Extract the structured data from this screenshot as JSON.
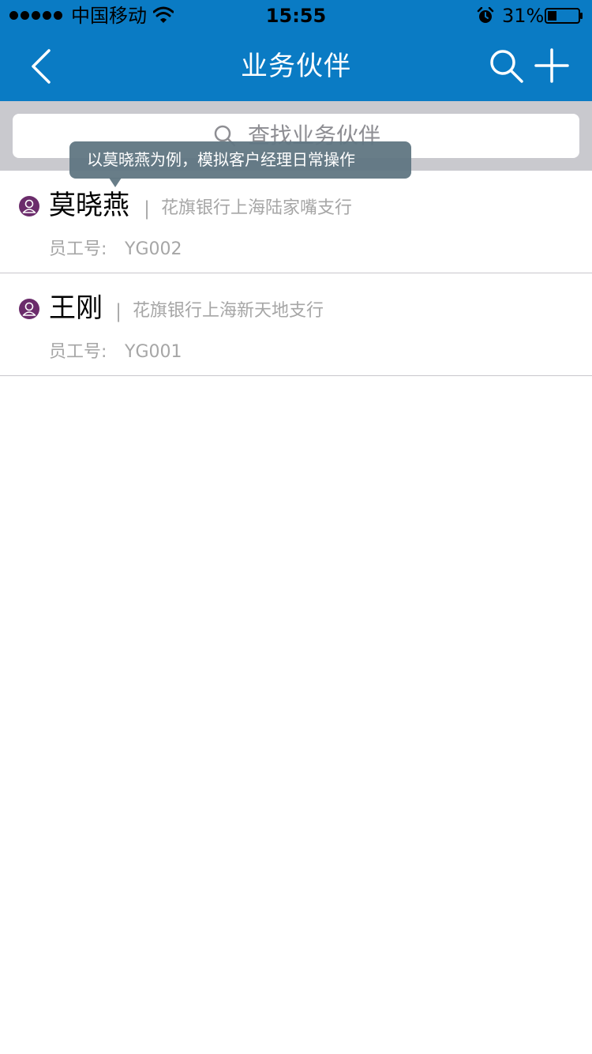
{
  "status_bar": {
    "carrier": "中国移动",
    "time": "15:55",
    "battery": "31%",
    "battery_level": 0.31,
    "icons": [
      "signal-dots-icon",
      "wifi-icon",
      "alarm-icon",
      "battery-icon"
    ]
  },
  "nav": {
    "title": "业务伙伴",
    "back_icon": "chevron-left-icon",
    "search_icon": "search-icon",
    "add_icon": "plus-icon"
  },
  "search": {
    "placeholder": "查找业务伙伴"
  },
  "tooltip": {
    "text": "以莫晓燕为例，模拟客户经理日常操作"
  },
  "partners": [
    {
      "name": "莫晓燕",
      "divider": "|",
      "branch": "花旗银行上海陆家嘴支行",
      "id_label": "员工号:",
      "id": "YG002"
    },
    {
      "name": "王刚",
      "divider": "|",
      "branch": "花旗银行上海新天地支行",
      "id_label": "员工号:",
      "id": "YG001"
    }
  ],
  "colors": {
    "primary": "#0a7bc4",
    "avatar": "#6b2c6b",
    "secondary_text": "#a6a6a6"
  }
}
